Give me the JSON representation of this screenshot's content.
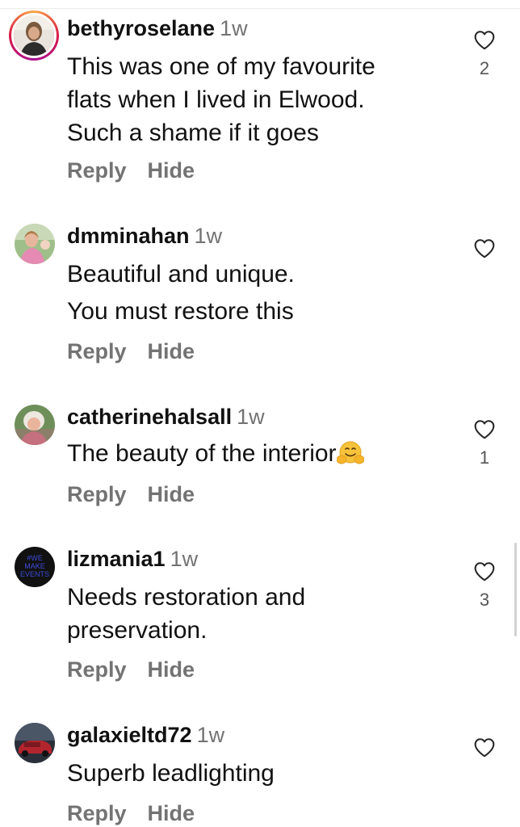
{
  "comments": [
    {
      "username": "bethyroselane",
      "time": "1w",
      "lines": [
        "This was one of my favourite",
        "flats when I lived in Elwood.",
        "Such a shame if it goes"
      ],
      "likes": "2",
      "actions": {
        "reply": "Reply",
        "hide": "Hide"
      }
    },
    {
      "username": "dmminahan",
      "time": "1w",
      "lines": [
        "Beautiful and unique.",
        "You must restore this"
      ],
      "likes": "",
      "actions": {
        "reply": "Reply",
        "hide": "Hide"
      }
    },
    {
      "username": "catherinehalsall",
      "time": "1w",
      "lines": [
        "The beauty of the interior"
      ],
      "emoji": "hugging-face-emoji",
      "likes": "1",
      "actions": {
        "reply": "Reply",
        "hide": "Hide"
      }
    },
    {
      "username": "lizmania1",
      "time": "1w",
      "lines": [
        "Needs restoration and",
        "preservation."
      ],
      "likes": "3",
      "avatar_text": [
        "#WE",
        "MAKE",
        "EVENTS"
      ],
      "actions": {
        "reply": "Reply",
        "hide": "Hide"
      }
    },
    {
      "username": "galaxieltd72",
      "time": "1w",
      "lines": [
        "Superb leadlighting"
      ],
      "likes": "",
      "actions": {
        "reply": "Reply",
        "hide": "Hide"
      }
    }
  ],
  "icons": {
    "like": "heart-outline-icon"
  },
  "colors": {
    "text": "#111111",
    "muted": "#737373",
    "story_ring": [
      "#fbaa47",
      "#d91a46",
      "#a60f93"
    ]
  }
}
